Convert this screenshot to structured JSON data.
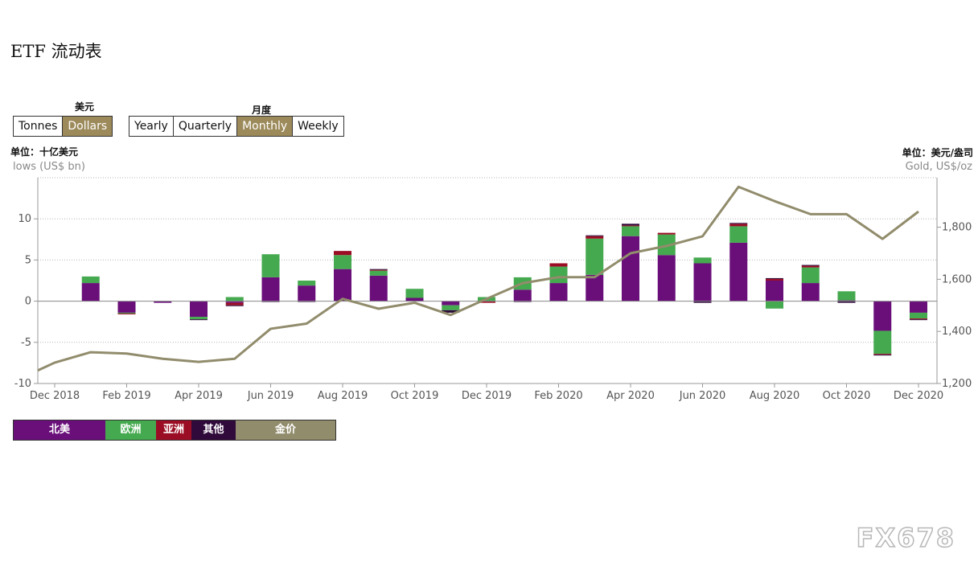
{
  "page": {
    "title": "ETF  流动表",
    "unit_left": "单位：十亿美元",
    "sub_left": "lows (US$ bn)",
    "unit_right": "单位：美元/盎司",
    "sub_right": "Gold, US$/oz",
    "watermark": "FX678"
  },
  "unit_toggle": {
    "caption": "美元",
    "options": [
      "Tonnes",
      "Dollars"
    ],
    "selected": "Dollars"
  },
  "period_toggle": {
    "caption": "月度",
    "options": [
      "Yearly",
      "Quarterly",
      "Monthly",
      "Weekly"
    ],
    "selected": "Monthly"
  },
  "legend": [
    {
      "label": "北美",
      "color": "#6a0f7a"
    },
    {
      "label": "欧洲",
      "color": "#45a94f"
    },
    {
      "label": "亚洲",
      "color": "#9b0d24"
    },
    {
      "label": "其他",
      "color": "#2f0a3a"
    },
    {
      "label": "金价",
      "color": "#918c6c"
    }
  ],
  "chart_data": {
    "type": "bar",
    "stacked": true,
    "categories": [
      "Dec 2018",
      "Jan 2019",
      "Feb 2019",
      "Mar 2019",
      "Apr 2019",
      "May 2019",
      "Jun 2019",
      "Jul 2019",
      "Aug 2019",
      "Sep 2019",
      "Oct 2019",
      "Nov 2019",
      "Dec 2019",
      "Jan 2020",
      "Feb 2020",
      "Mar 2020",
      "Apr 2020",
      "May 2020",
      "Jun 2020",
      "Jul 2020",
      "Aug 2020",
      "Sep 2020",
      "Oct 2020",
      "Nov 2020",
      "Dec 2020"
    ],
    "x_tick_labels": [
      "Dec 2018",
      "Feb 2019",
      "Apr 2019",
      "Jun 2019",
      "Aug 2019",
      "Oct 2019",
      "Dec 2019",
      "Feb 2020",
      "Apr 2020",
      "Jun 2020",
      "Aug 2020",
      "Oct 2020",
      "Dec 2020"
    ],
    "series": [
      {
        "name": "北美",
        "color": "#6a0f7a",
        "values": [
          null,
          2.2,
          -1.4,
          -0.2,
          -1.9,
          -0.2,
          2.9,
          1.9,
          3.9,
          3.1,
          0.4,
          -0.5,
          0.0,
          1.4,
          2.2,
          3.2,
          7.9,
          5.6,
          4.6,
          7.1,
          2.5,
          2.2,
          0.1,
          -3.6,
          -1.4
        ]
      },
      {
        "name": "欧洲",
        "color": "#45a94f",
        "values": [
          null,
          0.8,
          -0.1,
          0.0,
          -0.3,
          0.5,
          2.8,
          0.6,
          1.7,
          0.6,
          1.1,
          -0.6,
          0.5,
          1.5,
          2.0,
          4.4,
          1.2,
          2.5,
          0.7,
          2.0,
          -0.9,
          1.9,
          1.1,
          -2.8,
          -0.7
        ]
      },
      {
        "name": "亚洲",
        "color": "#9b0d24",
        "values": [
          null,
          0.0,
          -0.1,
          0.0,
          0.0,
          -0.3,
          0.0,
          0.0,
          0.5,
          0.1,
          0.0,
          0.0,
          -0.2,
          0.0,
          0.4,
          0.3,
          0.1,
          0.2,
          0.0,
          0.3,
          0.2,
          0.2,
          0.0,
          -0.1,
          -0.1
        ]
      },
      {
        "name": "其他",
        "color": "#2f0a3a",
        "values": [
          null,
          0.0,
          0.0,
          0.0,
          -0.1,
          -0.1,
          -0.1,
          -0.1,
          0.0,
          0.1,
          0.0,
          -0.3,
          0.0,
          -0.1,
          0.0,
          0.1,
          0.2,
          0.0,
          -0.2,
          0.1,
          0.1,
          0.1,
          -0.2,
          -0.1,
          -0.1
        ]
      }
    ],
    "line_series": {
      "name": "金价",
      "color": "#918c6c",
      "axis": "right",
      "values": [
        1250,
        1280,
        1320,
        1315,
        1295,
        1283,
        1295,
        1410,
        1430,
        1525,
        1487,
        1510,
        1463,
        1525,
        1585,
        1608,
        1608,
        1700,
        1728,
        1765,
        1955,
        1900,
        1850,
        1850,
        1755,
        1860
      ]
    },
    "ylim_left": [
      -10,
      15
    ],
    "yticks_left": [
      -10,
      -5,
      0,
      5,
      10
    ],
    "ylim_right": [
      1200,
      1990
    ],
    "yticks_right": [
      1200,
      1400,
      1600,
      1800
    ],
    "ytick_labels_right": [
      "1,200",
      "1,400",
      "1,600",
      "1,800"
    ],
    "grid": true,
    "legend_position": "bottom-left"
  }
}
